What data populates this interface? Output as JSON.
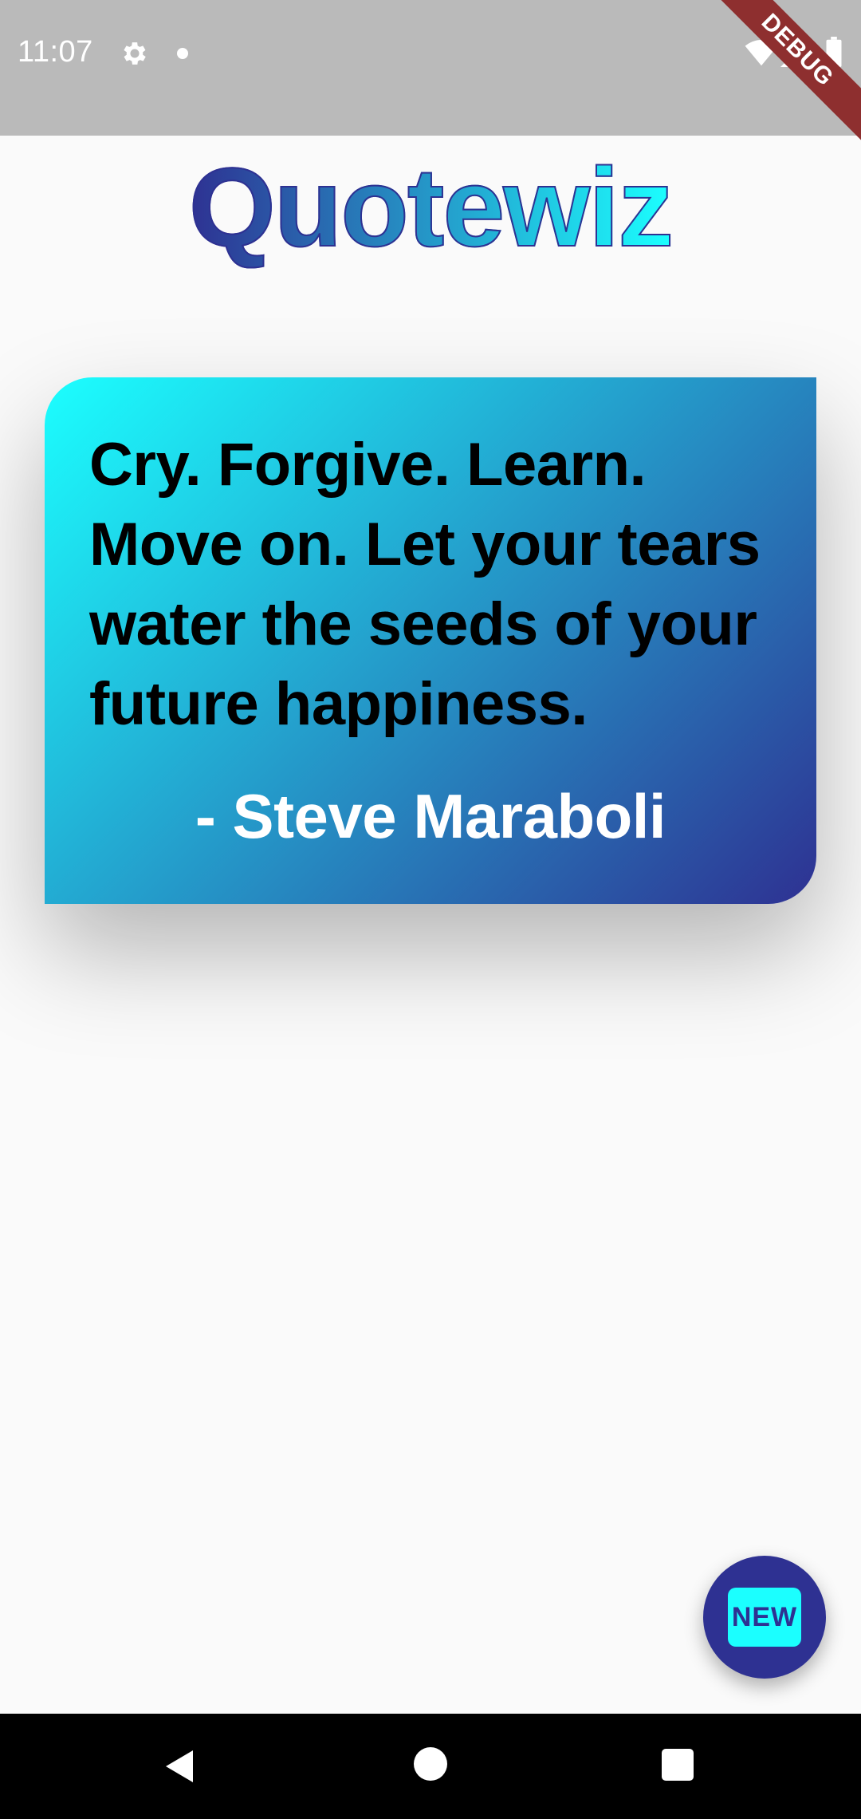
{
  "status_bar": {
    "time": "11:07",
    "icons": [
      "gear-icon",
      "notification-dot-icon",
      "wifi-icon",
      "signal-icon",
      "battery-icon"
    ],
    "debug_banner": "DEBUG"
  },
  "app": {
    "title": "Quotewiz"
  },
  "quote": {
    "text": "Cry. Forgive. Learn. Move on. Let your tears water the seeds of your future happiness.",
    "author": "- Steve Maraboli"
  },
  "fab": {
    "label": "NEW",
    "icon": "new-icon"
  },
  "nav_bar": {
    "icons": [
      "back-icon",
      "home-icon",
      "recent-apps-icon"
    ]
  },
  "colors": {
    "gradient_start": "#1bffff",
    "gradient_end": "#2e3192",
    "status_bar_bg": "#bababa",
    "page_bg": "#fafafa",
    "debug_banner_bg": "#8e2f2f"
  }
}
